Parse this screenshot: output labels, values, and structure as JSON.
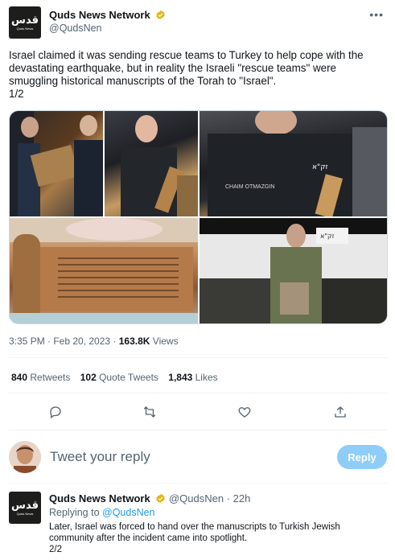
{
  "tweet": {
    "author_name": "Quds News Network",
    "author_handle": "@QudsNen",
    "text": "Israel claimed it was sending rescue teams to Turkey to help cope with the devastating earthquake, but in reality the Israeli \"rescue teams\" were smuggling historical manuscripts of the Torah to \"Israel\".\n1/2",
    "time": "3:35 PM · Feb 20, 2023 · ",
    "views_count": "163.8K",
    "views_label": " Views",
    "media_labels": {
      "jacket_name": "CHAIM OTMAZGIN",
      "brand": "זק\"א",
      "van_label": "זק\"א"
    }
  },
  "logo": {
    "mark": "قدس",
    "sub": "Quds News"
  },
  "stats": [
    {
      "count": "840",
      "label": " Retweets"
    },
    {
      "count": "102",
      "label": " Quote Tweets"
    },
    {
      "count": "1,843",
      "label": " Likes"
    }
  ],
  "icons": {
    "reply": "reply-icon",
    "retweet": "retweet-icon",
    "like": "heart-icon",
    "share": "share-icon",
    "more": "more-icon",
    "verified": "verified-badge-icon"
  },
  "colors": {
    "accent": "#1d9bf0",
    "reply_button": "#8ecdf8",
    "verified": "#e2b719",
    "secondary_text": "#536471"
  },
  "reply_box": {
    "placeholder": "Tweet your reply",
    "button": "Reply"
  },
  "thread": {
    "author_name": "Quds News Network",
    "handle_time": " @QudsNen · 22h",
    "replying_prefix": "Replying to ",
    "replying_to": "@QudsNen",
    "text": "Later, Israel was forced to hand over the manuscripts to Turkish Jewish community after the incident came into spotlight.\n2/2"
  }
}
